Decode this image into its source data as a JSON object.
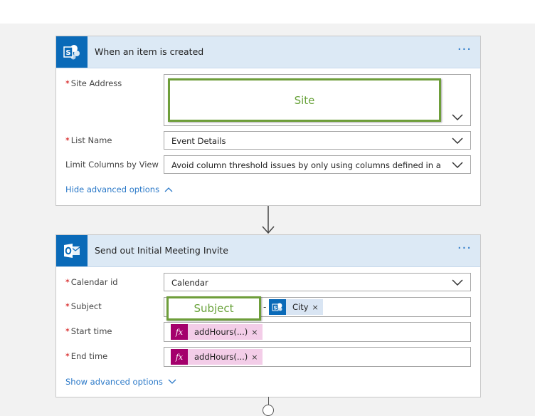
{
  "colors": {
    "accent": "#2b79c8",
    "header_bg": "#dce9f5",
    "sharepoint_blue": "#0a6ab8",
    "outlook_blue": "#0a6ab8",
    "required_star": "#d00000",
    "highlight_green": "#6e9e3a",
    "expression_magenta": "#a4006c",
    "expression_token_bg": "#f3cde8"
  },
  "trigger_card": {
    "icon": "sharepoint-icon",
    "title": "When an item is created",
    "menu_label": "···",
    "fields": {
      "site_address": {
        "required": "*",
        "label": "Site Address",
        "value": "Site"
      },
      "list_name": {
        "required": "*",
        "label": "List Name",
        "value": "Event Details"
      },
      "limit_columns": {
        "label": "Limit Columns by View",
        "value": "Avoid column threshold issues by only using columns defined in a view"
      }
    },
    "advanced_link": "Hide advanced options",
    "advanced_icon": "chevron-up-icon"
  },
  "connector": {
    "icon": "arrow-down-icon"
  },
  "action_card": {
    "icon": "outlook-icon",
    "title": "Send out Initial Meeting Invite",
    "menu_label": "···",
    "fields": {
      "calendar_id": {
        "required": "*",
        "label": "Calendar id",
        "value": "Calendar"
      },
      "subject": {
        "required": "*",
        "label": "Subject",
        "value": "Subject",
        "separator": "-",
        "token_label": "City",
        "token_icon": "sharepoint-icon"
      },
      "start_time": {
        "required": "*",
        "label": "Start time",
        "token_label": "addHours(...)",
        "token_icon": "fx-icon"
      },
      "end_time": {
        "required": "*",
        "label": "End time",
        "token_label": "addHours(...)",
        "token_icon": "fx-icon"
      }
    },
    "advanced_link": "Show advanced options",
    "advanced_icon": "chevron-down-icon",
    "token_close": "×",
    "fx_glyph": "fx"
  },
  "add_step": {
    "icon": "plus-circle-icon"
  }
}
